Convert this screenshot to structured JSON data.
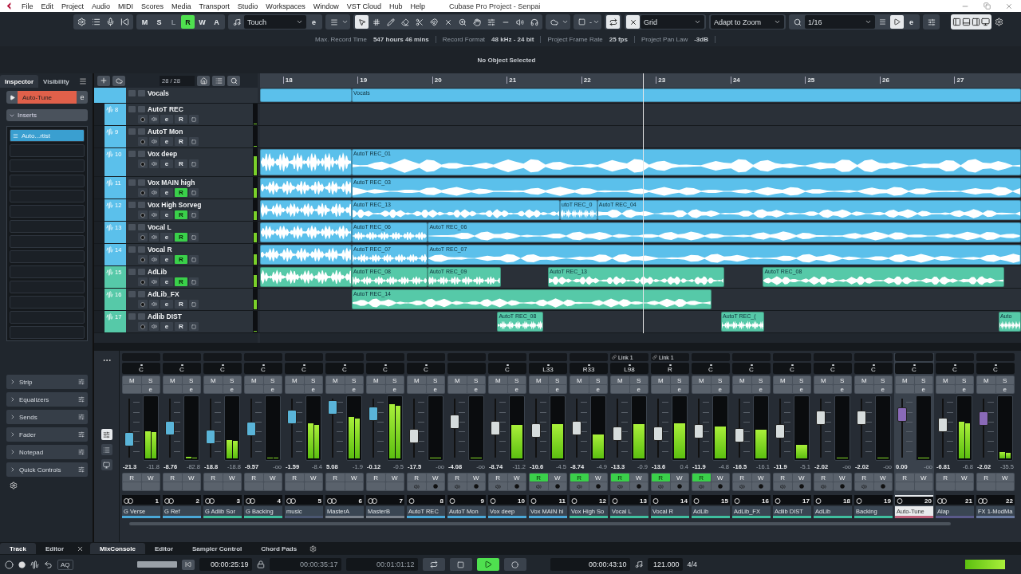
{
  "menu": [
    "File",
    "Edit",
    "Project",
    "Audio",
    "MIDI",
    "Scores",
    "Media",
    "Transport",
    "Studio",
    "Workspaces",
    "Window",
    "VST Cloud",
    "Hub",
    "Help"
  ],
  "window": {
    "title": "Cubase Pro Project - Senpai"
  },
  "toolbar": {
    "mode_buttons": [
      {
        "label": "M",
        "on": false,
        "disabled": false
      },
      {
        "label": "S",
        "on": false,
        "disabled": false
      },
      {
        "label": "L",
        "on": false,
        "disabled": true
      },
      {
        "label": "R",
        "on": true,
        "disabled": false
      },
      {
        "label": "W",
        "on": false,
        "disabled": false
      },
      {
        "label": "A",
        "on": false,
        "disabled": false
      }
    ],
    "automation_mode": "Touch",
    "edit": "e",
    "step": "-",
    "snap_type": "Grid",
    "grid_type": "Adapt to Zoom",
    "quantize": "1/16",
    "quantize_edit": "e"
  },
  "info": [
    {
      "label": "Max. Record Time",
      "value": "547 hours 46 mins"
    },
    {
      "label": "Record Format",
      "value": "48 kHz - 24 bit"
    },
    {
      "label": "Project Frame Rate",
      "value": "25 fps"
    },
    {
      "label": "Project Pan Law",
      "value": "-3dB"
    }
  ],
  "status": "No Object Selected",
  "inspector": {
    "tabs": [
      {
        "label": "Inspector",
        "selected": true
      },
      {
        "label": "Visibility",
        "selected": false
      }
    ],
    "track": "Auto-Tune",
    "edit": "e",
    "inserts": "Inserts",
    "slots": [
      "Auto...rtist"
    ],
    "sections": [
      "Strip",
      "Equalizers",
      "Sends",
      "Fader",
      "Notepad",
      "Quick Controls"
    ]
  },
  "track_list": {
    "count": "28 / 28"
  },
  "ruler": {
    "bars": [
      "18",
      "19",
      "20",
      "21",
      "22",
      "23",
      "24",
      "25",
      "26",
      "27"
    ]
  },
  "tracks": [
    {
      "name": "Vocals",
      "kind": "folder",
      "color": "#5bc0eb",
      "events": [
        {
          "kind": "folder"
        },
        {
          "kind": "folder",
          "label": "Vocals"
        }
      ]
    },
    {
      "number": "8",
      "name": "AutoT REC",
      "kind": "audio",
      "color": "#5bc0eb",
      "read": false,
      "r": "R",
      "edit": "e",
      "meter": {
        "level": 0
      }
    },
    {
      "number": "9",
      "name": "AutoT Mon",
      "kind": "audio",
      "color": "#5bc0eb",
      "read": false,
      "r": "R",
      "edit": "e",
      "meter": {
        "level": 0
      }
    },
    {
      "number": "10",
      "name": "Vox deep",
      "kind": "audio",
      "color": "#5bc0eb",
      "read": false,
      "r": "R",
      "edit": "e",
      "meter": {
        "level": 0.75
      },
      "events": [
        {
          "kind": "audio"
        },
        {
          "kind": "audio",
          "label": "AutoT REC_01"
        }
      ]
    },
    {
      "number": "11",
      "name": "Vox MAIN high",
      "kind": "audio",
      "color": "#5bc0eb",
      "read": true,
      "r": "R",
      "edit": "e",
      "meter": {
        "level": 0.5
      },
      "events": [
        {
          "kind": "audio"
        },
        {
          "kind": "audio",
          "label": "AutoT REC_03"
        }
      ]
    },
    {
      "number": "12",
      "name": "Vox High Sorveg",
      "kind": "audio",
      "color": "#5bc0eb",
      "read": true,
      "r": "R",
      "edit": "e",
      "meter": {
        "level": 0.45
      },
      "events": [
        {
          "kind": "audio"
        },
        {
          "kind": "audio",
          "label": "AutoT REC_13"
        },
        {
          "kind": "audio",
          "label": "utoT REC_0"
        },
        {
          "kind": "audio",
          "label": "AutoT REC_04"
        }
      ]
    },
    {
      "number": "13",
      "name": "Vocal L",
      "kind": "audio",
      "color": "#5bc0eb",
      "read": true,
      "r": "R",
      "edit": "e",
      "meter": {
        "level": 0.5
      },
      "events": [
        {
          "kind": "audio"
        },
        {
          "kind": "audio",
          "label": "AutoT REC_06"
        },
        {
          "kind": "audio",
          "label": "AutoT REC_06"
        }
      ]
    },
    {
      "number": "14",
      "name": "Vocal R",
      "kind": "audio",
      "color": "#5bc0eb",
      "read": true,
      "r": "R",
      "edit": "e",
      "meter": {
        "level": 0.55
      },
      "events": [
        {
          "kind": "audio"
        },
        {
          "kind": "audio",
          "label": "AutoT REC_07"
        },
        {
          "kind": "audio",
          "label": "AutoT REC_07"
        }
      ]
    },
    {
      "number": "15",
      "name": "AdLib",
      "kind": "audio",
      "color": "#56c9a8",
      "read": true,
      "r": "R",
      "edit": "e",
      "meter": {
        "level": 0.6
      },
      "events": [
        {
          "kind": "audio"
        },
        {
          "kind": "audio",
          "label": "AutoT REC_08"
        },
        {
          "kind": "audio",
          "label": "AutoT REC_09"
        },
        {
          "kind": "audio",
          "label": "AutoT REC_13"
        },
        {
          "kind": "audio",
          "label": "AutoT REC_08"
        }
      ]
    },
    {
      "number": "16",
      "name": "AdLib_FX",
      "kind": "audio",
      "color": "#56c9a8",
      "read": false,
      "r": "R",
      "edit": "e",
      "meter": {
        "level": 0.5
      },
      "events": [
        {
          "kind": "audio",
          "label": "AutoT REC_14"
        }
      ]
    },
    {
      "number": "17",
      "name": "Adlib DIST",
      "kind": "audio",
      "color": "#56c9a8",
      "read": false,
      "r": "R",
      "edit": "e",
      "meter": {
        "level": 0
      },
      "events": [
        {
          "kind": "audio",
          "label": "AutoT REC_08"
        },
        {
          "kind": "audio",
          "label": "AutoT REC_("
        },
        {
          "kind": "audio",
          "label": "Auto"
        }
      ]
    }
  ],
  "mixer": {
    "channels": [
      {
        "number": "1",
        "name": "G Verse",
        "kind": "group",
        "stereo": true,
        "color": "#4aa8d8",
        "pan": "C",
        "volume": "-21.3",
        "peak": "-11.8",
        "read": false,
        "selected": false,
        "fader": {
          "level": 0.28
        },
        "meter": {
          "level": 0.45
        },
        "m": "M",
        "s": "S",
        "e": "e",
        "r": "R",
        "w": "W"
      },
      {
        "number": "2",
        "name": "G Ref",
        "kind": "group",
        "stereo": true,
        "color": "#4aa8d8",
        "pan": "C",
        "volume": "-8.76",
        "peak": "-82.8",
        "read": false,
        "selected": false,
        "fader": {
          "level": 0.5
        },
        "meter": {
          "level": 0.02
        },
        "m": "M",
        "s": "S",
        "e": "e",
        "r": "R",
        "w": "W"
      },
      {
        "number": "3",
        "name": "G Adlib Sor",
        "kind": "group",
        "stereo": true,
        "color": "#3fbf9f",
        "pan": "C",
        "volume": "-18.8",
        "peak": "-18.8",
        "read": false,
        "selected": false,
        "fader": {
          "level": 0.33
        },
        "meter": {
          "level": 0.3
        },
        "m": "M",
        "s": "S",
        "e": "e",
        "r": "R",
        "w": "W"
      },
      {
        "number": "4",
        "name": "G Backing",
        "kind": "group",
        "stereo": true,
        "color": "#3fbf9f",
        "pan": "C",
        "volume": "-9.57",
        "peak": "-oo",
        "read": false,
        "selected": false,
        "fader": {
          "level": 0.48
        },
        "meter": {
          "level": 0
        },
        "m": "M",
        "s": "S",
        "e": "e",
        "r": "R",
        "w": "W"
      },
      {
        "number": "5",
        "name": "music",
        "kind": "group",
        "stereo": true,
        "color": "#4a5670",
        "pan": "C",
        "volume": "-1.59",
        "peak": "-8.4",
        "read": false,
        "selected": false,
        "fader": {
          "level": 0.71
        },
        "meter": {
          "level": 0.58
        },
        "m": "M",
        "s": "S",
        "e": "e",
        "r": "R",
        "w": "W"
      },
      {
        "number": "6",
        "name": "MasterA",
        "kind": "group",
        "stereo": true,
        "color": "#7a828c",
        "pan": "C",
        "volume": "5.08",
        "peak": "-1.9",
        "read": false,
        "selected": false,
        "fader": {
          "level": 0.9
        },
        "meter": {
          "level": 0.68
        },
        "m": "M",
        "s": "S",
        "e": "e",
        "r": "R",
        "w": "W"
      },
      {
        "number": "7",
        "name": "MasterB",
        "kind": "group",
        "stereo": true,
        "color": "#7a828c",
        "pan": "C",
        "volume": "-0.12",
        "peak": "-0.5",
        "read": false,
        "selected": false,
        "fader": {
          "level": 0.77
        },
        "meter": {
          "level": 0.9
        },
        "m": "M",
        "s": "S",
        "e": "e",
        "r": "R",
        "w": "W"
      },
      {
        "number": "8",
        "name": "AutoT REC",
        "kind": "audio",
        "stereo": false,
        "color": "#4aa8d8",
        "pan": "C",
        "volume": "-17.5",
        "peak": "-oo",
        "read": false,
        "selected": false,
        "fader": {
          "level": 0.35
        },
        "meter": {
          "level": 0
        },
        "m": "M",
        "s": "S",
        "e": "e",
        "r": "R",
        "w": "W"
      },
      {
        "number": "9",
        "name": "AutoT Mon",
        "kind": "audio",
        "stereo": false,
        "color": "#4aa8d8",
        "volume": "-4.08",
        "peak": "-oo",
        "read": false,
        "selected": false,
        "fader": {
          "level": 0.62
        },
        "meter": {
          "level": 0
        },
        "m": "M",
        "s": "S",
        "e": "e",
        "r": "R",
        "w": "W"
      },
      {
        "number": "10",
        "name": "Vox deep",
        "kind": "audio",
        "stereo": false,
        "color": "#4aa8d8",
        "pan": "C",
        "volume": "-8.74",
        "peak": "-11.2",
        "read": false,
        "selected": false,
        "fader": {
          "level": 0.5
        },
        "meter": {
          "level": 0.55
        },
        "m": "M",
        "s": "S",
        "e": "e",
        "r": "R",
        "w": "W"
      },
      {
        "number": "11",
        "name": "Vox MAIN hi",
        "kind": "audio",
        "stereo": false,
        "color": "#4aa8d8",
        "pan": "L33",
        "volume": "-10.6",
        "peak": "-4.5",
        "read": true,
        "selected": false,
        "fader": {
          "level": 0.46
        },
        "meter": {
          "level": 0.57
        },
        "m": "M",
        "s": "S",
        "e": "e",
        "r": "R",
        "w": "W"
      },
      {
        "number": "12",
        "name": "Vox High So",
        "kind": "audio",
        "stereo": false,
        "color": "#3fbf9f",
        "pan": "R33",
        "volume": "-8.74",
        "peak": "-4.9",
        "read": true,
        "selected": false,
        "fader": {
          "level": 0.5
        },
        "meter": {
          "level": 0.4
        },
        "m": "M",
        "s": "S",
        "e": "e",
        "r": "R",
        "w": "W"
      },
      {
        "number": "13",
        "name": "Vocal L",
        "kind": "audio",
        "stereo": false,
        "color": "#3fbf9f",
        "link": "Link 1",
        "pan": "L98",
        "volume": "-13.3",
        "peak": "-0.9",
        "read": true,
        "selected": false,
        "fader": {
          "level": 0.4
        },
        "meter": {
          "level": 0.57
        },
        "m": "M",
        "s": "S",
        "e": "e",
        "r": "R",
        "w": "W"
      },
      {
        "number": "14",
        "name": "Vocal R",
        "kind": "audio",
        "stereo": false,
        "color": "#3fbf9f",
        "link": "Link 1",
        "pan": "R",
        "volume": "-13.6",
        "peak": "0.4",
        "read": true,
        "selected": false,
        "fader": {
          "level": 0.4
        },
        "meter": {
          "level": 0.58
        },
        "m": "M",
        "s": "S",
        "e": "e",
        "r": "R",
        "w": "W"
      },
      {
        "number": "15",
        "name": "AdLib",
        "kind": "audio",
        "stereo": false,
        "color": "#3fbf9f",
        "pan": "C",
        "volume": "-11.9",
        "peak": "-4.8",
        "read": true,
        "selected": false,
        "fader": {
          "level": 0.44
        },
        "meter": {
          "level": 0.52
        },
        "m": "M",
        "s": "S",
        "e": "e",
        "r": "R",
        "w": "W"
      },
      {
        "number": "16",
        "name": "AdLib_FX",
        "kind": "audio",
        "stereo": false,
        "color": "#3fbf9f",
        "pan": "C",
        "volume": "-16.5",
        "peak": "-16.1",
        "read": false,
        "selected": false,
        "fader": {
          "level": 0.36
        },
        "meter": {
          "level": 0.47
        },
        "m": "M",
        "s": "S",
        "e": "e",
        "r": "R",
        "w": "W"
      },
      {
        "number": "17",
        "name": "Adlib DIST",
        "kind": "audio",
        "stereo": false,
        "color": "#3fbf9f",
        "pan": "C",
        "volume": "-11.9",
        "peak": "-5.1",
        "read": false,
        "selected": false,
        "fader": {
          "level": 0.44
        },
        "meter": {
          "level": 0.23
        },
        "m": "M",
        "s": "S",
        "e": "e",
        "r": "R",
        "w": "W"
      },
      {
        "number": "18",
        "name": "AdLib",
        "kind": "audio",
        "stereo": false,
        "color": "#3fbf9f",
        "pan": "C",
        "volume": "-2.02",
        "peak": "-oo",
        "read": false,
        "selected": false,
        "fader": {
          "level": 0.7
        },
        "meter": {
          "level": 0
        },
        "m": "M",
        "s": "S",
        "e": "e",
        "r": "R",
        "w": "W"
      },
      {
        "number": "19",
        "name": "Backing",
        "kind": "audio",
        "stereo": false,
        "color": "#3fbf9f",
        "pan": "C",
        "volume": "-2.02",
        "peak": "-oo",
        "read": false,
        "selected": false,
        "fader": {
          "level": 0.7
        },
        "meter": {
          "level": 0
        },
        "m": "M",
        "s": "S",
        "e": "e",
        "r": "R",
        "w": "W"
      },
      {
        "number": "20",
        "name": "Auto-Tune",
        "kind": "fx",
        "stereo": false,
        "color": "#c0607a",
        "pan": "C",
        "volume": "0.00",
        "peak": "-oo",
        "read": false,
        "selected": true,
        "fader": {
          "level": 0.76
        },
        "meter": {
          "level": 0
        },
        "m": "M",
        "s": "S",
        "e": "e",
        "r": "R",
        "w": "W"
      },
      {
        "number": "21",
        "name": "Alap",
        "kind": "instrument",
        "stereo": true,
        "color": "#5a5a8a",
        "pan": "C",
        "volume": "-6.81",
        "peak": "-6.8",
        "read": false,
        "selected": false,
        "fader": {
          "level": 0.56
        },
        "meter": {
          "level": 0.6
        },
        "m": "M",
        "s": "S",
        "e": "e",
        "r": "R",
        "w": "W"
      },
      {
        "number": "22",
        "name": "FX 1-ModMa",
        "kind": "fx",
        "stereo": true,
        "color": "#6a7aa0",
        "pan": "C",
        "volume": "-2.02",
        "peak": "-35.5",
        "read": false,
        "selected": false,
        "fader": {
          "level": 0.68
        },
        "meter": {
          "level": 0.1
        },
        "m": "M",
        "s": "S",
        "e": "e",
        "r": "R",
        "w": "W"
      }
    ]
  },
  "bottom_tabs": {
    "left": [
      {
        "label": "Track",
        "selected": true
      },
      {
        "label": "Editor",
        "selected": false
      }
    ],
    "right": [
      {
        "label": "MixConsole",
        "selected": true
      },
      {
        "label": "Editor",
        "selected": false
      },
      {
        "label": "Sampler Control",
        "selected": false
      },
      {
        "label": "Chord Pads",
        "selected": false
      }
    ]
  },
  "transport": {
    "aq": "AQ",
    "time_1": "00:00:25:19",
    "time_2": "00:00:35:17",
    "time_3": "00:01:01:12",
    "playing": true,
    "position": "00:00:43:10",
    "tempo": "121.000",
    "signature": "4/4"
  }
}
